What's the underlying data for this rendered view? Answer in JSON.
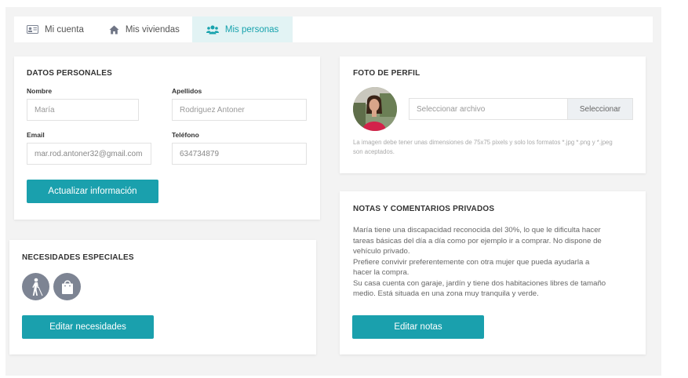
{
  "tabs": [
    {
      "label": "Mi cuenta",
      "icon": "id-card-icon"
    },
    {
      "label": "Mis viviendas",
      "icon": "home-icon"
    },
    {
      "label": "Mis personas",
      "icon": "people-icon"
    }
  ],
  "personal": {
    "title": "DATOS PERSONALES",
    "nombre_label": "Nombre",
    "nombre_value": "María",
    "apellidos_label": "Apellidos",
    "apellidos_value": "Rodriguez Antoner",
    "email_label": "Email",
    "email_value": "mar.rod.antoner32@gmail.com",
    "telefono_label": "Teléfono",
    "telefono_value": "634734879",
    "update_button": "Actualizar información"
  },
  "profile": {
    "title": "FOTO DE PERFIL",
    "file_placeholder": "Seleccionar archivo",
    "select_button": "Seleccionar",
    "note": "La imagen debe tener unas dimensiones de 75x75 pixels y solo los formatos *.jpg *.png y *.jpeg son aceptados."
  },
  "needs": {
    "title": "NECESIDADES ESPECIALES",
    "icons": [
      "blind-person-icon",
      "shopping-bag-icon"
    ],
    "edit_button": "Editar necesidades"
  },
  "notes": {
    "title": "NOTAS Y COMENTARIOS PRIVADOS",
    "lines": [
      "María tiene una discapacidad reconocida del 30%, lo que le dificulta hacer",
      "tareas básicas del día a día como por ejemplo ir a comprar. No dispone de",
      "vehículo privado.",
      "Prefiere convivir preferentemente con otra mujer que pueda ayudarla a",
      "hacer la compra.",
      "Su casa cuenta con garaje, jardín y tiene dos habitaciones libres de tamaño",
      "medio. Está situada en una zona muy tranquila y verde."
    ],
    "edit_button": "Editar notas"
  },
  "colors": {
    "accent": "#1aa0ad",
    "active_tab_bg": "#e2f3f4",
    "icon_circle": "#7d8493"
  }
}
